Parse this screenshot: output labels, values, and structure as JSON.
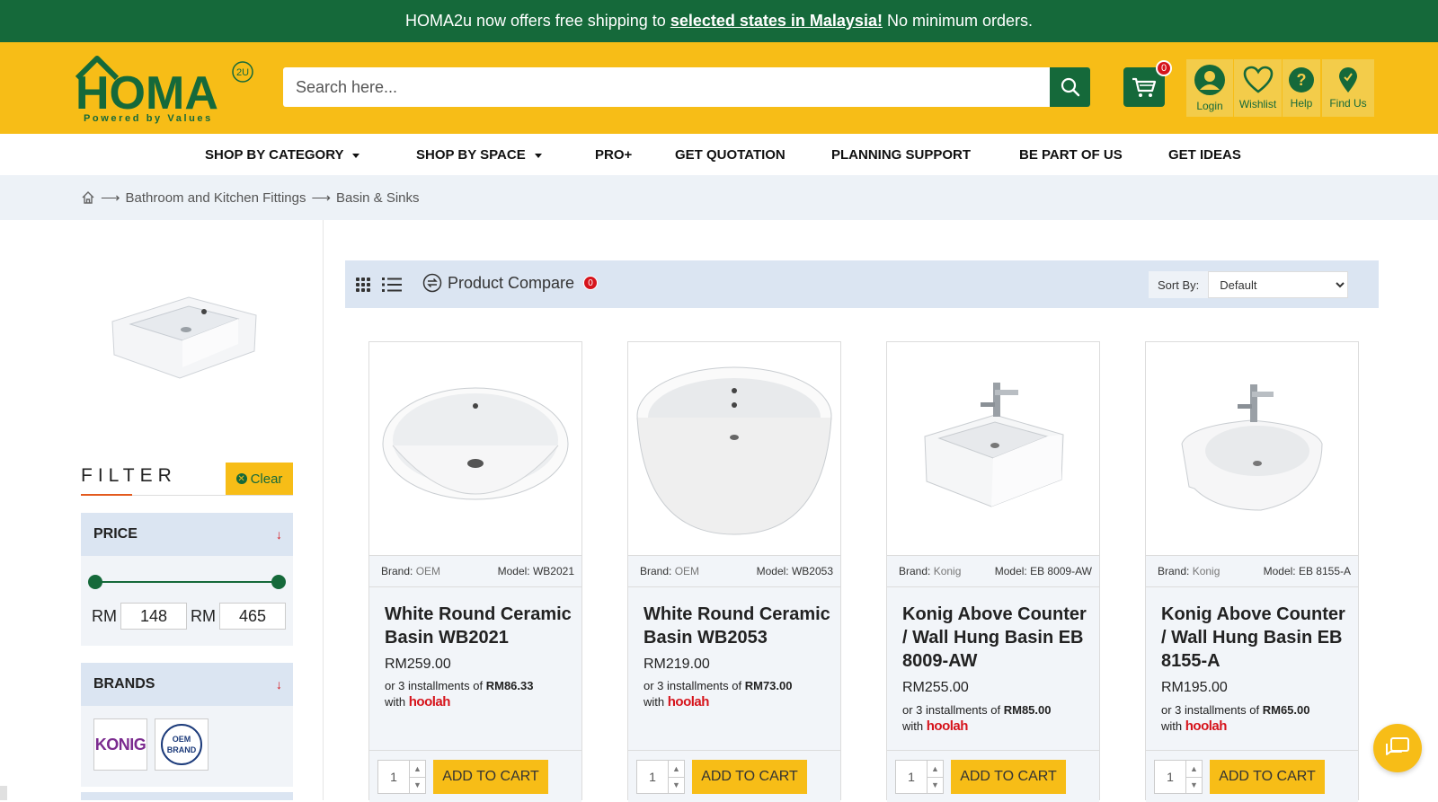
{
  "promo": {
    "before": "HOMA2u now offers free shipping to",
    "link": "selected states in Malaysia!",
    "after": "No minimum orders."
  },
  "header": {
    "logo_text": "HOMA",
    "logo_badge": "2U",
    "logo_tagline": "Powered by Values",
    "search_placeholder": "Search here...",
    "cart_count": "0",
    "icons": [
      {
        "label": "Login",
        "icon": "user-icon"
      },
      {
        "label": "Wishlist",
        "icon": "heart-icon"
      },
      {
        "label": "Help",
        "icon": "help-icon"
      },
      {
        "label": "Find Us",
        "icon": "location-pin-icon"
      }
    ]
  },
  "nav": {
    "items": [
      "SHOP BY CATEGORY",
      "SHOP BY SPACE",
      "PRO+",
      "GET QUOTATION",
      "PLANNING SUPPORT",
      "BE PART OF US",
      "GET IDEAS"
    ]
  },
  "breadcrumb": {
    "items": [
      "Bathroom and Kitchen Fittings",
      "Basin & Sinks"
    ]
  },
  "sidebar": {
    "filter_title": "FILTER",
    "clear_label": "Clear",
    "price": {
      "title": "PRICE",
      "currency": "RM",
      "min": "148",
      "max": "465"
    },
    "brands": {
      "title": "BRANDS",
      "items": [
        "KONIG",
        "OEM BRAND"
      ]
    }
  },
  "toolbar": {
    "compare_label": "Product Compare",
    "compare_count": "0",
    "sort_label": "Sort By:",
    "sort_value": "Default"
  },
  "products": [
    {
      "brand_label": "Brand:",
      "brand": "OEM",
      "model": "Model: WB2021",
      "title": "White Round Ceramic Basin WB2021",
      "price": "RM259.00",
      "inst_prefix": "or 3 installments of",
      "inst_amount": "RM86.33",
      "with": "with",
      "provider": "hoolah",
      "qty": "1",
      "cta": "ADD TO CART"
    },
    {
      "brand_label": "Brand:",
      "brand": "OEM",
      "model": "Model: WB2053",
      "title": "White Round Ceramic Basin WB2053",
      "price": "RM219.00",
      "inst_prefix": "or 3 installments of",
      "inst_amount": "RM73.00",
      "with": "with",
      "provider": "hoolah",
      "qty": "1",
      "cta": "ADD TO CART"
    },
    {
      "brand_label": "Brand:",
      "brand": "Konig",
      "model": "Model: EB 8009-AW",
      "title": "Konig Above Counter / Wall Hung Basin EB 8009-AW",
      "price": "RM255.00",
      "inst_prefix": "or 3 installments of",
      "inst_amount": "RM85.00",
      "with": "with",
      "provider": "hoolah",
      "qty": "1",
      "cta": "ADD TO CART"
    },
    {
      "brand_label": "Brand:",
      "brand": "Konig",
      "model": "Model: EB 8155-A",
      "title": "Konig Above Counter / Wall Hung Basin EB 8155-A",
      "price": "RM195.00",
      "inst_prefix": "or 3 installments of",
      "inst_amount": "RM65.00",
      "with": "with",
      "provider": "hoolah",
      "qty": "1",
      "cta": "ADD TO CART"
    }
  ],
  "colors": {
    "green": "#15693a",
    "yellow": "#f7bd17",
    "red": "#d6141c",
    "panel": "#dbe5f2"
  }
}
